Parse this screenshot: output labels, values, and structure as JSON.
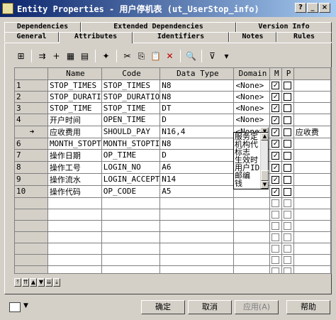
{
  "window": {
    "title": "Entity Properties - 用户停机表 (ut_UserStop_info)",
    "buttons": {
      "help": "?",
      "minimize": "_",
      "maximize": "□",
      "close": "×"
    }
  },
  "tabs": {
    "row_top": [
      "Dependencies",
      "Extended Dependencies",
      "Version Info"
    ],
    "row_mid": [
      "General",
      "Attributes",
      "Identifiers",
      "Notes",
      "Rules"
    ],
    "active": "Attributes"
  },
  "toolbar": {
    "icons": [
      "properties-icon",
      "insert-row-icon",
      "add-row-icon",
      "add-columns-icon",
      "copy-row-icon",
      "wizard-icon",
      "cut-icon",
      "copy-icon",
      "paste-icon",
      "delete-icon",
      "find-icon",
      "filter-icon",
      "customize-columns-icon"
    ],
    "glyphs": [
      "⊞",
      "⇉",
      "+",
      "▦",
      "▤",
      "✦",
      "✂",
      "⎘",
      "📋",
      "✕",
      "🔍",
      "⊽",
      "▾"
    ]
  },
  "grid": {
    "columns": [
      "Name",
      "Code",
      "Data Type",
      "Domain",
      "M",
      "P"
    ],
    "rows": [
      {
        "num": "1",
        "name": "STOP_TIMES",
        "code": "STOP_TIMES",
        "type": "N8",
        "domain": "<None>",
        "m": "✓"
      },
      {
        "num": "2",
        "name": "STOP_DURATI",
        "code": "STOP_DURATIO",
        "type": "N8",
        "domain": "<None>",
        "m": "✓"
      },
      {
        "num": "3",
        "name": "STOP_TIME",
        "code": "STOP_TIME",
        "type": "DT",
        "domain": "<None>",
        "m": "✓"
      },
      {
        "num": "4",
        "name": "开户时间",
        "code": "OPEN_TIME",
        "type": "D",
        "domain": "<None>",
        "m": "✓"
      },
      {
        "num": "➜",
        "name": "应收费用",
        "code": "SHOULD_PAY",
        "type": "N16,4",
        "domain": "<None>",
        "m": "✓",
        "extra": "应收费"
      },
      {
        "num": "6",
        "name": "MONTH_STOPT",
        "code": "MONTH_STOPTI",
        "type": "N8",
        "domain": "",
        "m": "✓"
      },
      {
        "num": "7",
        "name": "操作日期",
        "code": "OP_TIME",
        "type": "D",
        "domain": "",
        "m": "✓"
      },
      {
        "num": "8",
        "name": "操作工号",
        "code": "LOGIN_NO",
        "type": "A6",
        "domain": "",
        "m": "✓"
      },
      {
        "num": "9",
        "name": "操作流水",
        "code": "LOGIN_ACCEPT",
        "type": "N14",
        "domain": "",
        "m": "✓"
      },
      {
        "num": "10",
        "name": "操作代码",
        "code": "OP_CODE",
        "type": "A5",
        "domain": "",
        "m": "✓"
      }
    ],
    "empty_rows": 8
  },
  "domain_popup": {
    "items": [
      "服务定",
      "机构代",
      "标志",
      "生效时",
      "用户ID",
      "邮编",
      "钱"
    ]
  },
  "navbar": [
    "⤒",
    "⇈",
    "▲",
    "▼",
    "⇊",
    "⤓"
  ],
  "footer": {
    "ok": "确定",
    "cancel": "取消",
    "apply": "应用(A)",
    "help": "帮助"
  }
}
